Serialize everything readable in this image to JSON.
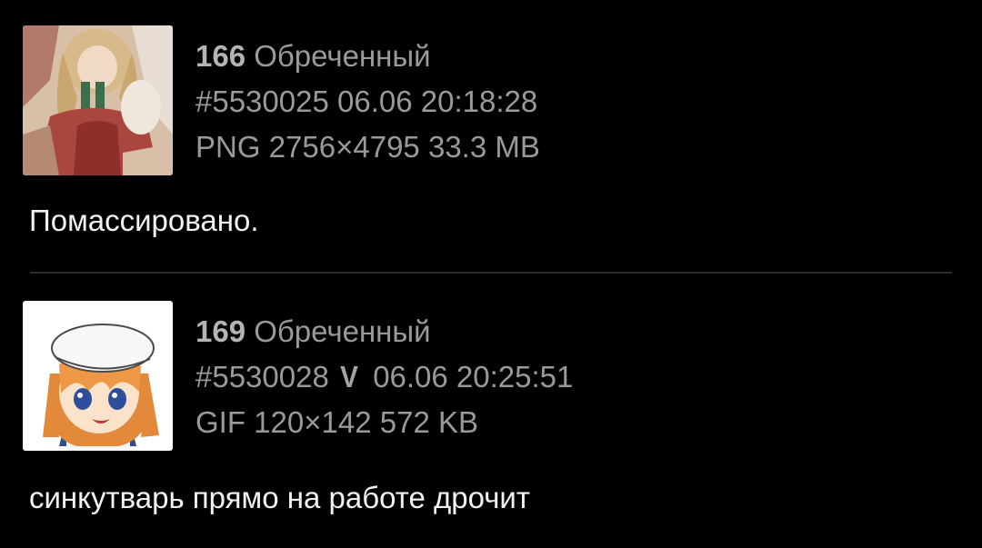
{
  "posts": [
    {
      "number": "166",
      "name": "Обреченный",
      "id": "#5530025",
      "sage": false,
      "date": "06.06 20:18:28",
      "file": {
        "type": "PNG",
        "dimensions": "2756×4795",
        "size": "33.3 MB"
      },
      "thumb_icon": "anime-girl-thumbnail",
      "comment": "Помассировано."
    },
    {
      "number": "169",
      "name": "Обреченный",
      "id": "#5530028",
      "sage": true,
      "sage_icon": "sage-down-arrow-icon",
      "sage_glyph": "V",
      "date": "06.06 20:25:51",
      "file": {
        "type": "GIF",
        "dimensions": "120×142",
        "size": "572 KB"
      },
      "thumb_icon": "anime-girl-beret-thumbnail",
      "comment": "синкутварь прямо на работе дрочит"
    }
  ],
  "colors": {
    "background": "#000000",
    "meta_text": "#9a9a9a",
    "comment_text": "#f2f2f2",
    "divider": "#2c2c2c"
  }
}
